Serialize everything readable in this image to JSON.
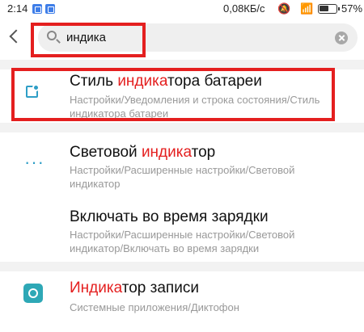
{
  "status_bar": {
    "time": "2:14",
    "notification_icons": [
      "app-notification-icon",
      "app-notification-icon"
    ],
    "net_speed": "0,08КБ/с",
    "mute_icon": "mute-icon",
    "wifi_icon": "wifi-icon",
    "battery_percent_value": 57,
    "battery_text": "57%"
  },
  "search": {
    "query": "индика",
    "back_icon": "back-arrow-icon",
    "search_icon": "search-icon",
    "clear_icon": "clear-icon"
  },
  "results": [
    {
      "icon": "battery-style-icon",
      "title_before": "Стиль ",
      "title_match": "индика",
      "title_after": "тора батареи",
      "path": "Настройки/Уведомления и строка состояния/Стиль индикатора батареи"
    },
    {
      "icon": "more-dots-icon",
      "title_before": "Световой ",
      "title_match": "индика",
      "title_after": "тор",
      "path": "Настройки/Расширенные настройки/Световой индикатор"
    },
    {
      "icon": "",
      "title_before": "Включать во время зарядки",
      "title_match": "",
      "title_after": "",
      "path": "Настройки/Расширенные настройки/Световой индикатор/Включать во время зарядки"
    },
    {
      "icon": "record-icon",
      "title_before": "",
      "title_match": "Индика",
      "title_after": "тор записи",
      "path": "Системные приложения/Диктофон"
    }
  ],
  "colors": {
    "highlight_box": "#e41f1f",
    "match_text": "#e41f1f",
    "icon_accent": "#2e9ec6",
    "divider": "#f2f2f2"
  }
}
